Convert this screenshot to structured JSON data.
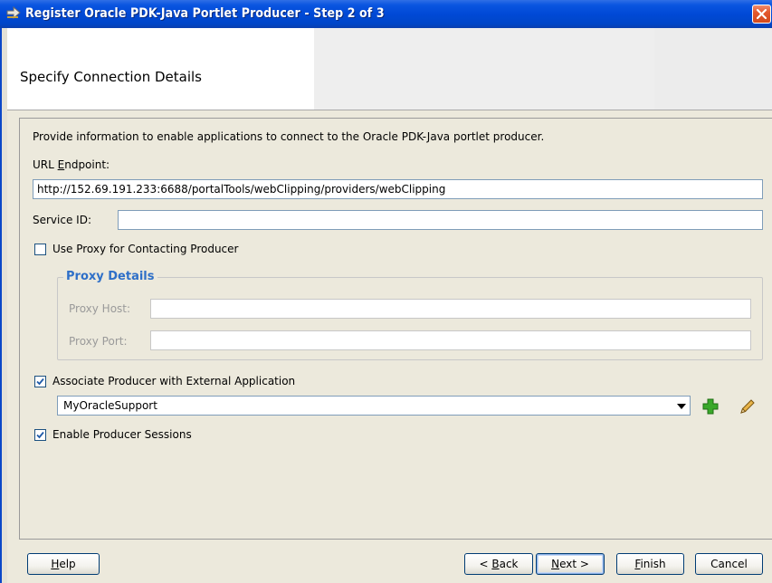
{
  "window": {
    "title": "Register Oracle PDK-Java Portlet Producer - Step 2 of 3",
    "app_icon": "arrow-icon",
    "close_icon": "close-icon"
  },
  "header": {
    "title": "Specify Connection Details"
  },
  "form": {
    "intro": "Provide information to enable applications to connect to the Oracle PDK-Java portlet producer.",
    "url_endpoint_label_pre": "URL ",
    "url_endpoint_label_mnemonic": "E",
    "url_endpoint_label_post": "ndpoint:",
    "url_endpoint_value": "http://152.69.191.233:6688/portalTools/webClipping/providers/webClipping",
    "service_id_label": "Service ID:",
    "service_id_value": "",
    "use_proxy_label": "Use Proxy for Contacting Producer",
    "use_proxy_checked": false,
    "proxy_group_title": "Proxy Details",
    "proxy_host_label": "Proxy Host:",
    "proxy_host_value": "",
    "proxy_port_label": "Proxy Port:",
    "proxy_port_value": "",
    "associate_label": "Associate Producer with External Application",
    "associate_checked": true,
    "external_app_selected": "MyOracleSupport",
    "add_icon": "plus-icon",
    "edit_icon": "pencil-icon",
    "sessions_label": "Enable Producer Sessions",
    "sessions_checked": true
  },
  "buttons": {
    "help_pre": "",
    "help_mn": "H",
    "help_post": "elp",
    "back_pre": "< ",
    "back_mn": "B",
    "back_post": "ack",
    "next_pre": "",
    "next_mn": "N",
    "next_post": "ext >",
    "finish_pre": "",
    "finish_mn": "F",
    "finish_post": "inish",
    "cancel": "Cancel"
  },
  "colors": {
    "titlebar": "#0049d6",
    "group_title": "#2e6fc8",
    "add_icon": "#2e9a1a",
    "close_button": "#d24a1d"
  }
}
